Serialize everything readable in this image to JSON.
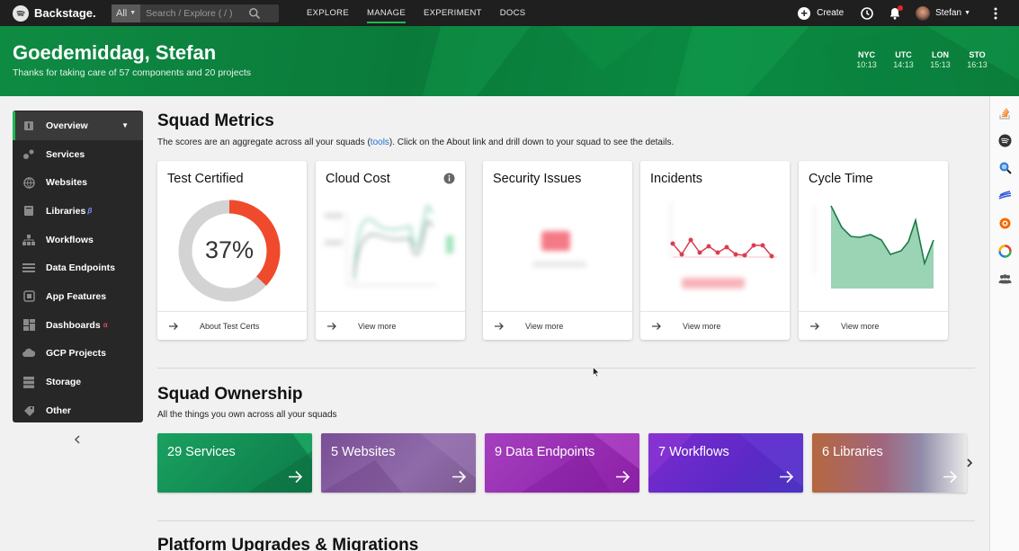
{
  "topbar": {
    "brand": "Backstage.",
    "search_scope": "All",
    "search_placeholder": "Search / Explore ( / )",
    "nav": [
      "EXPLORE",
      "MANAGE",
      "EXPERIMENT",
      "DOCS"
    ],
    "active_nav": "MANAGE",
    "create_label": "Create",
    "user_name": "Stefan"
  },
  "hero": {
    "greeting": "Goedemiddag, Stefan",
    "subtitle": "Thanks for taking care of 57 components and 20 projects",
    "clocks": [
      {
        "city": "NYC",
        "time": "10:13"
      },
      {
        "city": "UTC",
        "time": "14:13"
      },
      {
        "city": "LON",
        "time": "15:13"
      },
      {
        "city": "STO",
        "time": "16:13"
      }
    ]
  },
  "sidebar": {
    "items": [
      {
        "label": "Overview",
        "icon": "overview-icon"
      },
      {
        "label": "Services",
        "icon": "services-icon"
      },
      {
        "label": "Websites",
        "icon": "websites-icon"
      },
      {
        "label": "Libraries",
        "icon": "libraries-icon",
        "badge": "β"
      },
      {
        "label": "Workflows",
        "icon": "workflows-icon"
      },
      {
        "label": "Data Endpoints",
        "icon": "data-endpoints-icon"
      },
      {
        "label": "App Features",
        "icon": "app-features-icon"
      },
      {
        "label": "Dashboards",
        "icon": "dashboards-icon",
        "badge": "α"
      },
      {
        "label": "GCP Projects",
        "icon": "gcp-projects-icon"
      },
      {
        "label": "Storage",
        "icon": "storage-icon"
      },
      {
        "label": "Other",
        "icon": "other-icon"
      }
    ]
  },
  "metrics": {
    "title": "Squad Metrics",
    "desc_before": "The scores are an aggregate across all your squads (",
    "desc_link": "tools",
    "desc_after": "). Click on the About link and drill down to your squad to see the details.",
    "cards": [
      {
        "title": "Test Certified",
        "footer": "About Test Certs",
        "value": "37%",
        "fraction": 0.37
      },
      {
        "title": "Cloud Cost",
        "footer": "View more"
      },
      {
        "title": "Security Issues",
        "footer": "View more"
      },
      {
        "title": "Incidents",
        "footer": "View more"
      },
      {
        "title": "Cycle Time",
        "footer": "View more"
      }
    ]
  },
  "ownership": {
    "title": "Squad Ownership",
    "desc": "All the things you own across all your squads",
    "tiles": [
      {
        "label": "29 Services"
      },
      {
        "label": "5 Websites"
      },
      {
        "label": "9 Data Endpoints"
      },
      {
        "label": "7 Workflows"
      },
      {
        "label": "6 Libraries"
      }
    ]
  },
  "upgrades": {
    "title": "Platform Upgrades & Migrations"
  },
  "colors": {
    "accent": "#1db954",
    "hero_green": "#0a7a3a",
    "donut_red": "#f04a2c"
  }
}
